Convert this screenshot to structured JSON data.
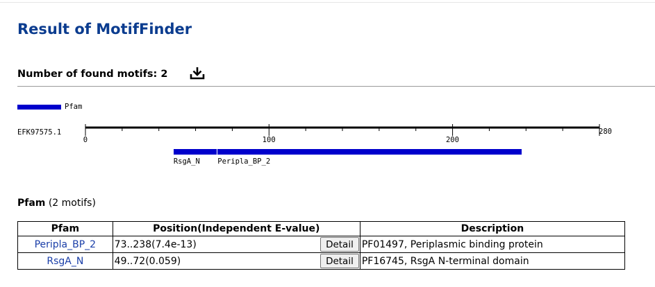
{
  "page": {
    "title": "Result of MotifFinder"
  },
  "summary": {
    "found_label": "Number of found motifs: 2",
    "download_icon": "download-icon"
  },
  "figure": {
    "legend": [
      {
        "name": "Pfam",
        "color": "#0000cc"
      }
    ],
    "sequence_id": "EFK97575.1",
    "sequence_length": 280,
    "tick_labels": [
      "0",
      "100",
      "200",
      "280"
    ],
    "tick_values": [
      0,
      100,
      200,
      280
    ],
    "domains": [
      {
        "name": "RsgA_N",
        "start": 49,
        "end": 72,
        "color": "#0000cc"
      },
      {
        "name": "Peripla_BP_2",
        "start": 73,
        "end": 238,
        "color": "#0000cc"
      }
    ]
  },
  "results": {
    "db_name": "Pfam",
    "db_count": "(2 motifs)",
    "headers": [
      "Pfam",
      "Position(Independent E-value)",
      "Description"
    ],
    "detail_label": "Detail",
    "rows": [
      {
        "name": "Peripla_BP_2",
        "position": "73..238(7.4e-13)",
        "description": "PF01497, Periplasmic binding protein"
      },
      {
        "name": "RsgA_N",
        "position": "49..72(0.059)",
        "description": "PF16745, RsgA N-terminal domain"
      }
    ]
  }
}
